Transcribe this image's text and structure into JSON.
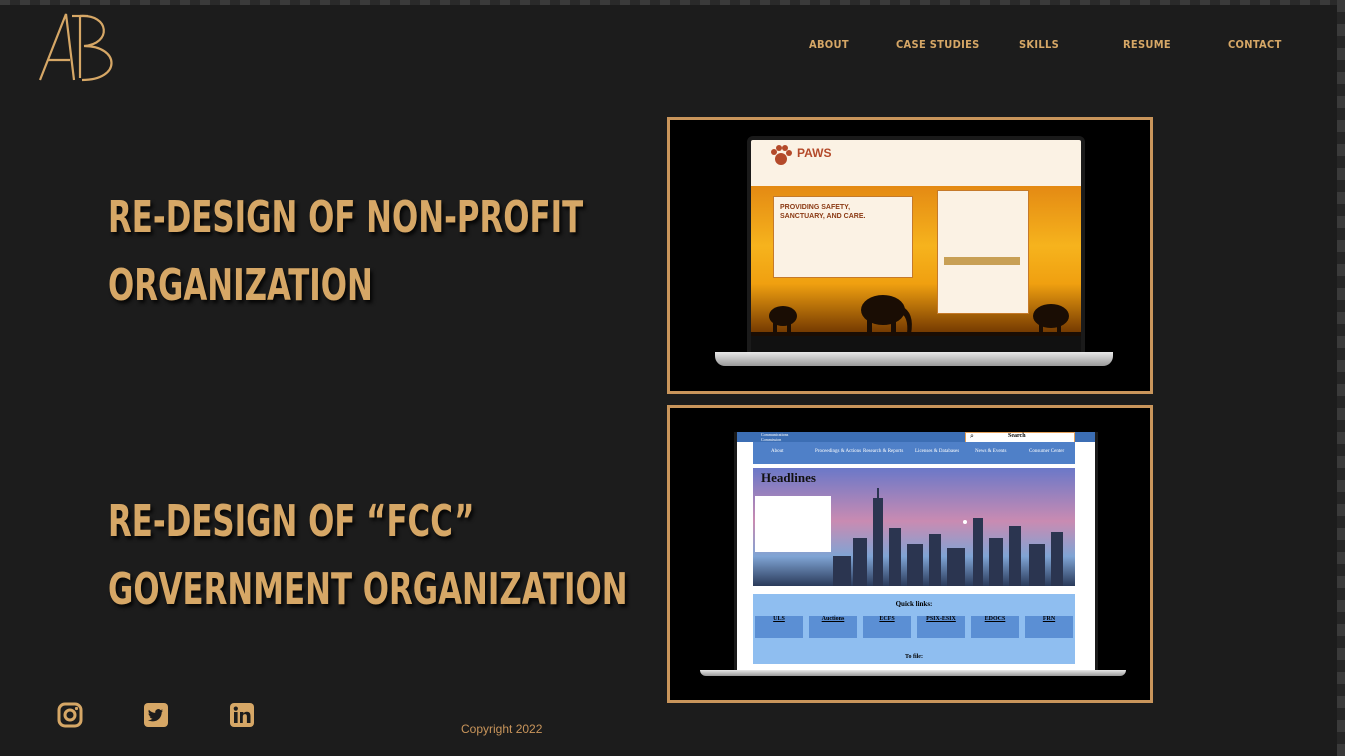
{
  "brand": {
    "logo": "AB"
  },
  "nav": {
    "items": [
      {
        "label": "ABOUT"
      },
      {
        "label": "CASE STUDIES"
      },
      {
        "label": "SKILLS"
      },
      {
        "label": "RESUME"
      },
      {
        "label": "CONTACT"
      }
    ]
  },
  "projects": [
    {
      "line1": "RE-DESIGN OF NON-PROFIT",
      "line2": "ORGANIZATION"
    },
    {
      "line1": "RE-DESIGN OF “FCC”",
      "line2": "GOVERNMENT ORGANIZATION"
    }
  ],
  "paws_mock": {
    "name": "PAWS",
    "card_title_1": "PROVIDING SAFETY,",
    "card_title_2": "SANCTUARY, AND CARE."
  },
  "fcc_mock": {
    "agency_1": "Communications",
    "agency_2": "Commission",
    "search": "Search",
    "nav": [
      "About",
      "Proceedings & Actions",
      "Research & Reports",
      "Licenses & Databases",
      "News & Events",
      "Consumer Center"
    ],
    "headline": "Headlines",
    "quick_links": "Quick links:",
    "links": [
      "ULS",
      "Auctions",
      "ECFS",
      "PSIX-ESIX",
      "EDOCS",
      "FRN"
    ],
    "to_file": "To file:"
  },
  "social": [
    "instagram-icon",
    "twitter-icon",
    "linkedin-icon"
  ],
  "footer": {
    "copyright": "Copyright 2022"
  },
  "colors": {
    "background": "#1c1c1c",
    "accent": "#d6a766",
    "frame": "#c9955b"
  }
}
